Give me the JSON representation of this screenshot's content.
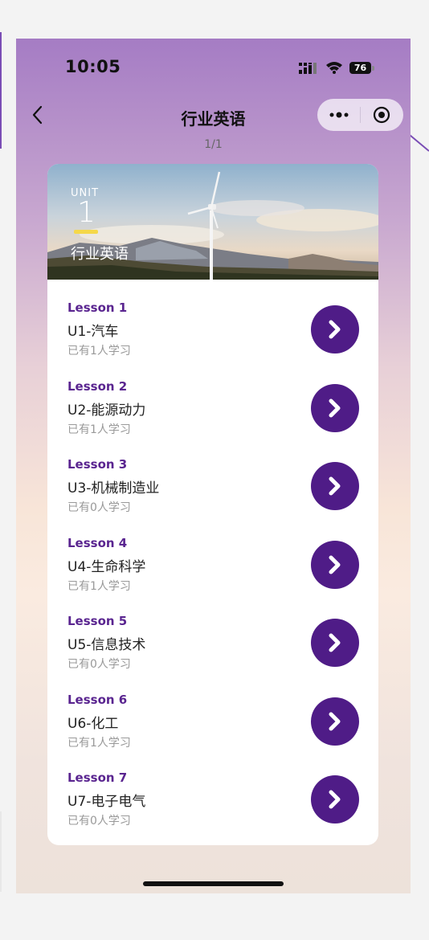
{
  "status_bar": {
    "time": "10:05",
    "battery": "76"
  },
  "nav": {
    "title": "行业英语"
  },
  "pager": "1/1",
  "unit": {
    "label": "UNIT",
    "number": "1",
    "title": "行业英语"
  },
  "lessons": [
    {
      "num": "Lesson 1",
      "name": "U1-汽车",
      "count": "已有1人学习"
    },
    {
      "num": "Lesson 2",
      "name": "U2-能源动力",
      "count": "已有1人学习"
    },
    {
      "num": "Lesson 3",
      "name": "U3-机械制造业",
      "count": "已有0人学习"
    },
    {
      "num": "Lesson 4",
      "name": "U4-生命科学",
      "count": "已有1人学习"
    },
    {
      "num": "Lesson 5",
      "name": "U5-信息技术",
      "count": "已有0人学习"
    },
    {
      "num": "Lesson 6",
      "name": "U6-化工",
      "count": "已有1人学习"
    },
    {
      "num": "Lesson 7",
      "name": "U7-电子电气",
      "count": "已有0人学习"
    }
  ],
  "colors": {
    "accent": "#4f1c87",
    "lesson_label": "#5a2590",
    "highlight": "#f5d84a"
  },
  "icons": [
    "back-icon",
    "more-icon",
    "target-icon",
    "chevron-right-icon",
    "signal-icon",
    "wifi-icon",
    "battery-icon"
  ]
}
